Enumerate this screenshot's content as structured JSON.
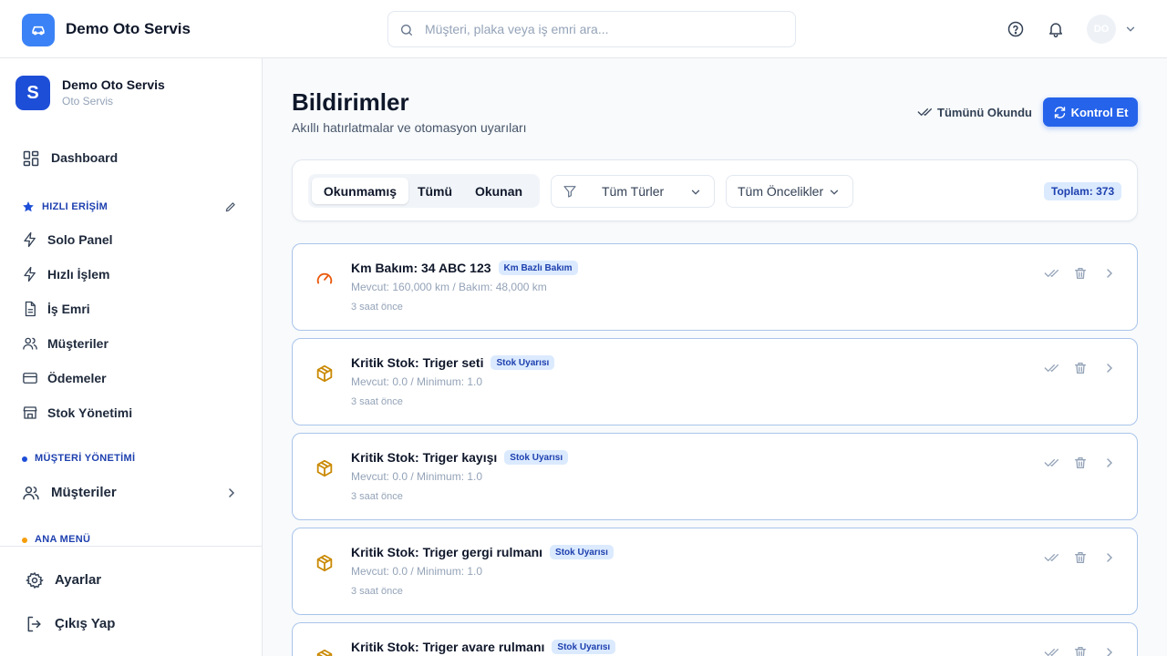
{
  "app": {
    "title": "Demo Oto Servis"
  },
  "search": {
    "placeholder": "Müşteri, plaka veya iş emri ara..."
  },
  "header": {
    "avatar_initials": "DO"
  },
  "sidebar": {
    "workspace_logo": "S",
    "workspace_name": "Demo Oto Servis",
    "workspace_sub": "Oto Servis",
    "dashboard": "Dashboard",
    "quick_access_title": "HIZLI ERİŞİM",
    "quick_items": [
      {
        "label": "Solo Panel",
        "icon": "bolt-icon"
      },
      {
        "label": "Hızlı İşlem",
        "icon": "bolt-icon"
      },
      {
        "label": "İş Emri",
        "icon": "document-icon"
      },
      {
        "label": "Müşteriler",
        "icon": "users-icon"
      },
      {
        "label": "Ödemeler",
        "icon": "credit-card-icon"
      },
      {
        "label": "Stok Yönetimi",
        "icon": "store-icon"
      }
    ],
    "customer_section_title": "MÜŞTERİ YÖNETİMİ",
    "customer_item": "Müşteriler",
    "main_menu_title": "ANA MENÜ",
    "settings": "Ayarlar",
    "logout": "Çıkış Yap"
  },
  "page": {
    "title": "Bildirimler",
    "subtitle": "Akıllı hatırlatmalar ve otomasyon uyarıları",
    "mark_all_read": "Tümünü Okundu",
    "check_button": "Kontrol Et"
  },
  "filters": {
    "tabs": [
      "Okunmamış",
      "Tümü",
      "Okunan"
    ],
    "active_tab": "Okunmamış",
    "type_filter": "Tüm Türler",
    "priority_filter": "Tüm Öncelikler",
    "total_label": "Toplam: 373"
  },
  "notifications": [
    {
      "title": "Km Bakım: 34 ABC 123",
      "badge": "Km Bazlı Bakım",
      "desc": "Mevcut: 160,000 km / Bakım: 48,000 km",
      "time": "3 saat önce",
      "icon": "speedometer-icon"
    },
    {
      "title": "Kritik Stok: Triger seti",
      "badge": "Stok Uyarısı",
      "desc": "Mevcut: 0.0 / Minimum: 1.0",
      "time": "3 saat önce",
      "icon": "box-icon"
    },
    {
      "title": "Kritik Stok: Triger kayışı",
      "badge": "Stok Uyarısı",
      "desc": "Mevcut: 0.0 / Minimum: 1.0",
      "time": "3 saat önce",
      "icon": "box-icon"
    },
    {
      "title": "Kritik Stok: Triger gergi rulmanı",
      "badge": "Stok Uyarısı",
      "desc": "Mevcut: 0.0 / Minimum: 1.0",
      "time": "3 saat önce",
      "icon": "box-icon"
    },
    {
      "title": "Kritik Stok: Triger avare rulmanı",
      "badge": "Stok Uyarısı",
      "desc": "",
      "time": "",
      "icon": "box-icon"
    }
  ],
  "colors": {
    "primary": "#2563eb",
    "brand": "#3b82f6",
    "workspace": "#1d4ed8",
    "badge_bg": "#dbeafe",
    "badge_text": "#1e40af",
    "card_border": "#a9c4ea",
    "km_icon": "#ea580c",
    "stock_icon": "#ca8a04",
    "section_dot_blue": "#1d4ed8",
    "section_dot_orange": "#f59e0b"
  }
}
